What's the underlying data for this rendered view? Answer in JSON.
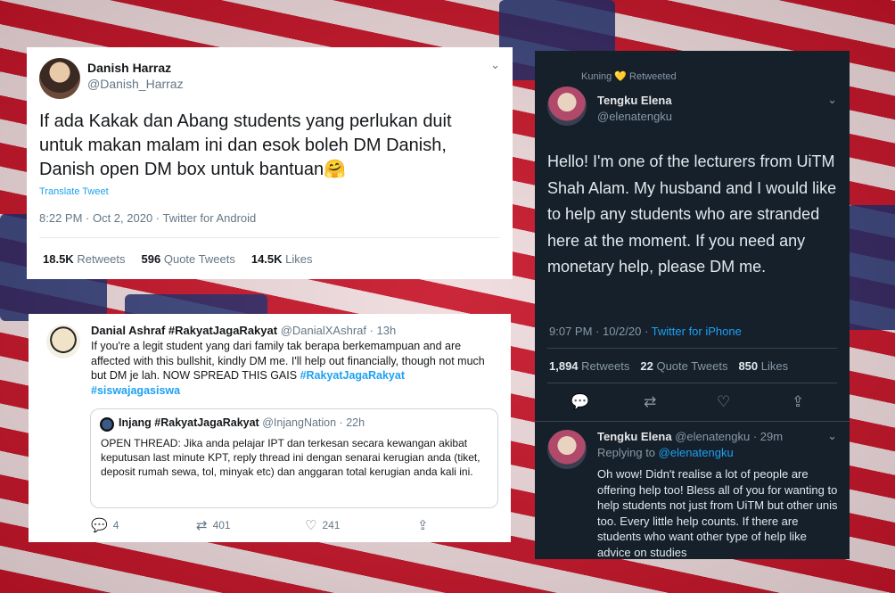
{
  "card1": {
    "name": "Danish Harraz",
    "handle": "@Danish_Harraz",
    "text": "If ada Kakak dan Abang students yang perlukan duit untuk makan malam ini dan esok boleh DM Danish, Danish open DM box untuk bantuan🤗",
    "translate": "Translate Tweet",
    "meta": "8:22 PM · Oct 2, 2020 · Twitter for Android",
    "retweets_count": "18.5K",
    "retweets_label": "Retweets",
    "quotes_count": "596",
    "quotes_label": "Quote Tweets",
    "likes_count": "14.5K",
    "likes_label": "Likes"
  },
  "card2": {
    "name": "Danial Ashraf #RakyatJagaRakyat",
    "handle_time": "@DanialXAshraf · 13h",
    "text_plain": "If you're a legit student yang dari family tak berapa berkemampuan and are affected with this bullshit, kindly DM me. I'll help out financially, though not much but DM je lah. NOW SPREAD THIS GAIS ",
    "hashtag1": "#RakyatJagaRakyat",
    "hashtag2": "#siswajagasiswa",
    "quote": {
      "name": "Injang #RakyatJagaRakyat",
      "handle_time": "@InjangNation · 22h",
      "text": "OPEN THREAD: Jika anda pelajar IPT dan terkesan secara kewangan akibat keputusan last minute KPT, reply thread ini dengan senarai kerugian anda (tiket, deposit rumah sewa, tol, minyak etc) dan anggaran total kerugian anda kali ini."
    },
    "replies": "4",
    "retweets": "401",
    "likes": "241"
  },
  "card3": {
    "retweeted_by": "Kuning 💛 Retweeted",
    "name": "Tengku Elena",
    "handle": "@elenatengku",
    "text": "Hello! I'm one of the lecturers from UiTM Shah Alam. My husband and I would like to help any students who are stranded here at the moment. If you need any monetary help, please DM me.",
    "meta_time": "9:07 PM · 10/2/20 · ",
    "meta_source": "Twitter for iPhone",
    "retweets_count": "1,894",
    "retweets_label": "Retweets",
    "quotes_count": "22",
    "quotes_label": "Quote Tweets",
    "likes_count": "850",
    "likes_label": "Likes",
    "reply": {
      "name": "Tengku Elena",
      "handle_time": "@elenatengku · 29m",
      "replying_prefix": "Replying to ",
      "replying_to": "@elenatengku",
      "text": "Oh wow! Didn't realise a lot of people are offering help too! Bless all of you for wanting to help students not just from UiTM but other unis too. Every little help counts. If there are students who want other type of help like advice on studies"
    }
  },
  "icons": {
    "chevron": "⌄",
    "reply": "💬",
    "retweet": "⇄",
    "like": "♡",
    "share": "⇪"
  }
}
